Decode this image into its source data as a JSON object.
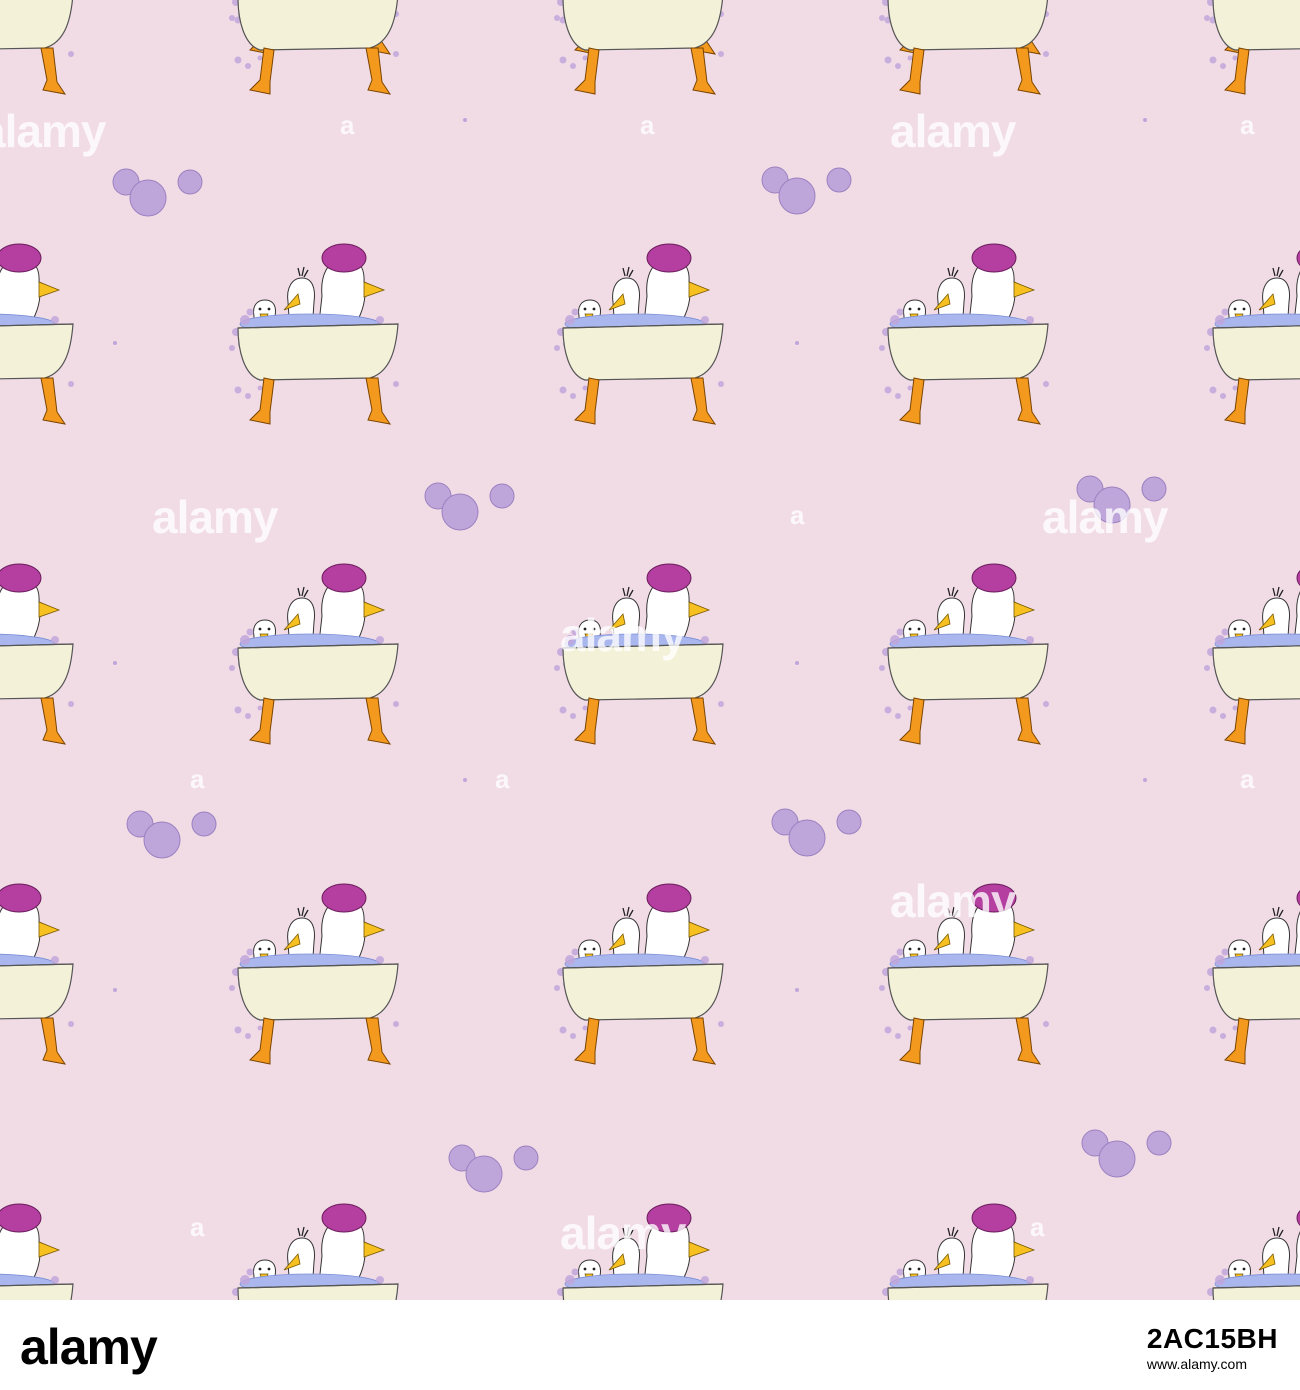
{
  "pattern": {
    "background_color": "#f1dce6",
    "bubble_color": "#bfa6da",
    "bubble_stroke": "#9b81c0",
    "tub_color": "#f4f1d9",
    "duck_color": "#ffffff",
    "beak_color": "#f6c021",
    "feet_color": "#f39a1e",
    "cap_color": "#b43fa0",
    "foam_color": "#a9b7ee"
  },
  "watermark": {
    "text": "alamy",
    "small_text": "a"
  },
  "footer": {
    "logo": "alamy",
    "image_id": "2AC15BH",
    "site": "www.alamy.com"
  }
}
